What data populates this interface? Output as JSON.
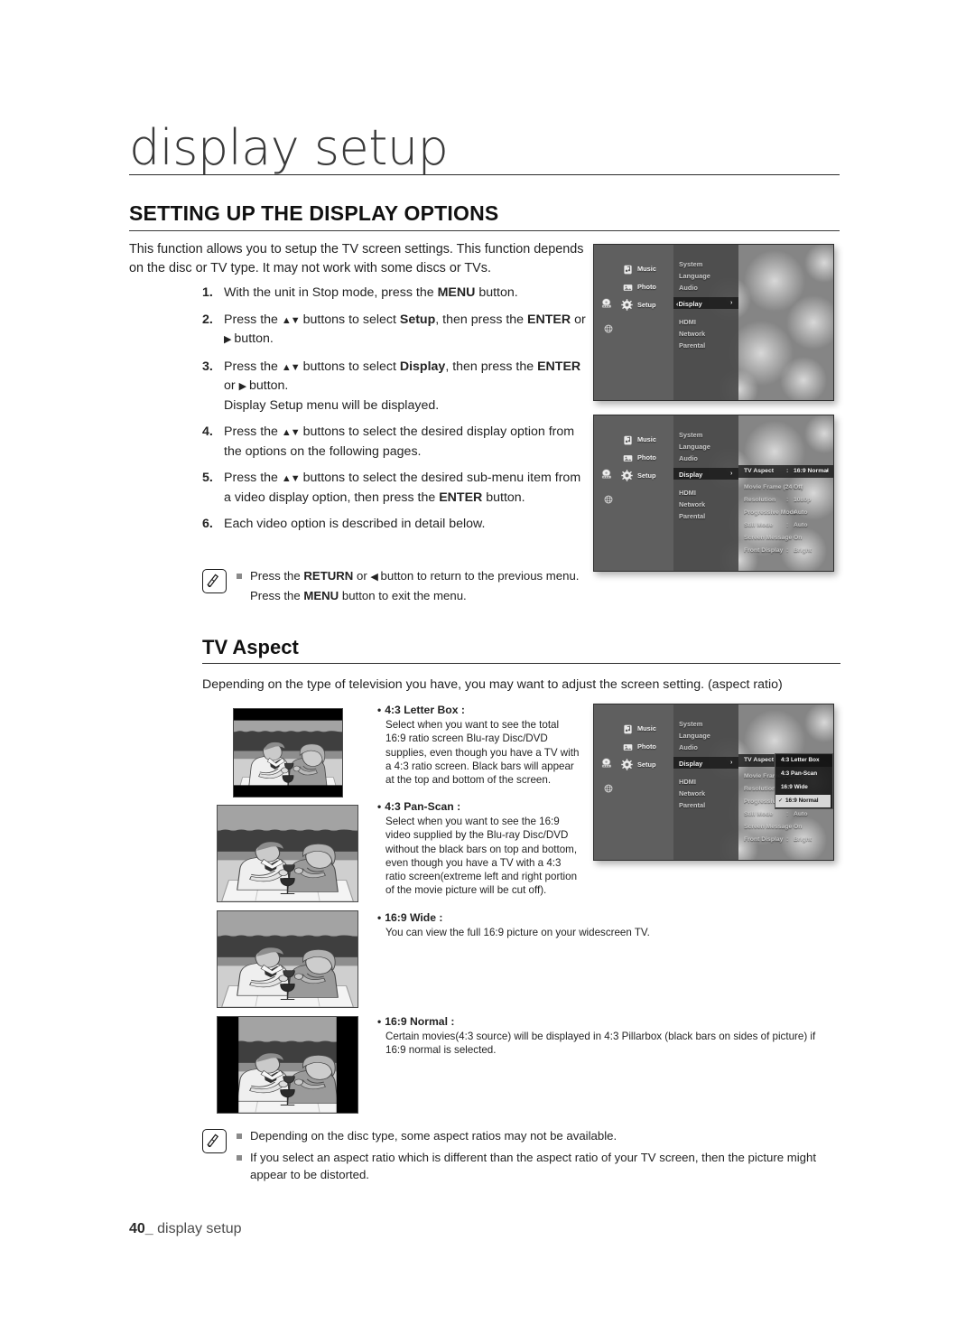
{
  "header": {
    "chapter_title": "display setup",
    "section_title": "SETTING UP THE DISPLAY OPTIONS"
  },
  "intro": "This function allows you to setup the TV screen settings. This function depends on the disc or TV type. It may not work with some discs or TVs.",
  "steps": [
    {
      "num": "1.",
      "html": "With the unit in Stop mode, press the <b>MENU</b> button."
    },
    {
      "num": "2.",
      "html": "Press the <span class=\"tri\">▲▼</span> buttons to select <b>Setup</b>, then press the <b>ENTER</b> or <span class=\"tri\">▶</span> button."
    },
    {
      "num": "3.",
      "html": "Press the <span class=\"tri\">▲▼</span> buttons to select <b>Display</b>, then press the <b>ENTER</b> or <span class=\"tri\">▶</span> button.<br>Display Setup menu will be displayed."
    },
    {
      "num": "4.",
      "html": "Press the <span class=\"tri\">▲▼</span> buttons to select the desired display option from the options on the following pages."
    },
    {
      "num": "5.",
      "html": "Press the <span class=\"tri\">▲▼</span> buttons to select the desired sub-menu item from a video display option, then press the <b>ENTER</b> button."
    },
    {
      "num": "6.",
      "html": "Each video option is described in detail below."
    }
  ],
  "note_top": {
    "icon": "note-pen-icon",
    "lines": [
      "Press the <b>RETURN</b> or <span class=\"tri\">◀</span> button to return to the previous menu. Press the <b>MENU</b> button to exit the menu."
    ]
  },
  "tv_aspect": {
    "title": "TV Aspect",
    "intro": "Depending on the type of television you have, you may want to adjust the screen setting. (aspect ratio)",
    "options": [
      {
        "label": "4:3 Letter Box :",
        "body": "Select when you want to see the total 16:9 ratio screen Blu-ray Disc/DVD supplies, even though you have a TV with a 4:3 ratio screen. Black bars will appear at the top and bottom of the screen.",
        "illustration": "letterbox-tv-illustration"
      },
      {
        "label": "4:3 Pan-Scan :",
        "body": "Select when you want to see the 16:9 video supplied by the Blu-ray Disc/DVD without the black bars on top and bottom, even though you have a TV with a 4:3 ratio screen(extreme left and right portion of the movie picture will be cut off).",
        "illustration": "panscan-tv-illustration"
      },
      {
        "label": "16:9 Wide :",
        "body": "You can view the full 16:9 picture on your widescreen TV.",
        "illustration": "wide-tv-illustration"
      },
      {
        "label": "16:9 Normal :",
        "body": "Certain movies(4:3 source) will be displayed in 4:3 Pillarbox (black bars on sides of picture) if 16:9 normal is selected.",
        "illustration": "normal-tv-illustration"
      }
    ]
  },
  "note_bottom": {
    "icon": "note-pen-icon",
    "lines": [
      "Depending on the disc type, some aspect ratios may not be available.",
      "If you select an aspect ratio which is different than the aspect ratio of your TV screen, then the picture might appear to be distorted."
    ]
  },
  "osd": {
    "sidebar": [
      {
        "label": "Music",
        "icon": "music-note-icon"
      },
      {
        "label": "Photo",
        "icon": "photo-icon"
      },
      {
        "label": "Setup",
        "icon": "gear-icon"
      },
      {
        "label": "",
        "icon": "globe-icon"
      }
    ],
    "menu_items": [
      "System",
      "Language",
      "Audio",
      "Display",
      "HDMI",
      "Network",
      "Parental"
    ],
    "display_settings": [
      {
        "label": "TV Aspect",
        "value": "16:9 Normal"
      },
      {
        "label": "Movie Frame (24 Fs)",
        "value": "Off"
      },
      {
        "label": "Resolution",
        "value": "1080p"
      },
      {
        "label": "Progressive Mode",
        "value": "Auto"
      },
      {
        "label": "Still Mode",
        "value": "Auto"
      },
      {
        "label": "Screen Message",
        "value": "On"
      },
      {
        "label": "Front Display",
        "value": "Bright"
      }
    ],
    "aspect_dropdown": {
      "options": [
        "4:3 Letter Box",
        "4:3 Pan-Scan",
        "16:9 Wide",
        "16:9 Normal"
      ],
      "selected": "16:9 Normal",
      "check_glyph": "✓"
    },
    "screens": [
      {
        "name": "setup-display-highlighted",
        "selected": "Display"
      },
      {
        "name": "display-settings-list",
        "selected": "TV Aspect"
      },
      {
        "name": "tv-aspect-dropdown-open",
        "selected": "16:9 Normal"
      }
    ]
  },
  "footer": {
    "page_number": "40",
    "underscore": "_",
    "label": "display setup"
  }
}
